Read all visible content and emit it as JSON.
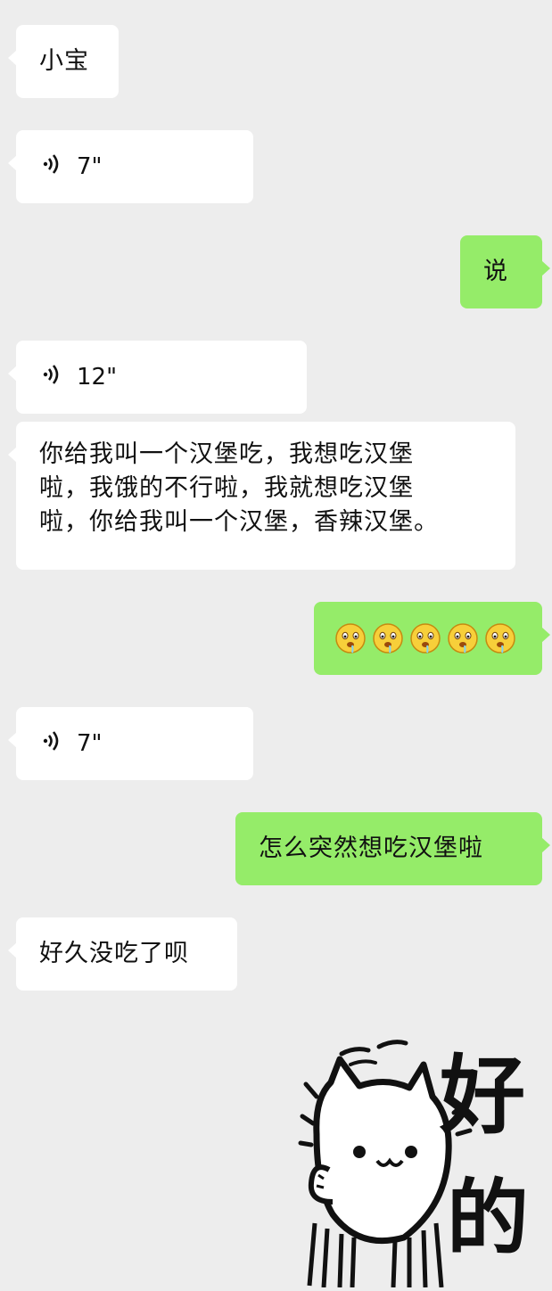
{
  "messages": [
    {
      "side": "left",
      "type": "text",
      "text": "小宝"
    },
    {
      "side": "left",
      "type": "voice",
      "duration": "7\""
    },
    {
      "side": "right",
      "type": "text",
      "text": "说"
    },
    {
      "side": "left",
      "type": "voice",
      "duration": "12\""
    },
    {
      "side": "left",
      "type": "text",
      "lines": [
        "你给我叫一个汉堡吃，我想吃汉堡",
        "啦，我饿的不行啦，我就想吃汉堡",
        "啦，你给我叫一个汉堡，香辣汉堡。"
      ]
    },
    {
      "side": "right",
      "type": "emoji",
      "emoji": "drooling-face",
      "count": 5
    },
    {
      "side": "left",
      "type": "voice",
      "duration": "7\""
    },
    {
      "side": "right",
      "type": "text",
      "text": "怎么突然想吃汉堡啦"
    },
    {
      "side": "left",
      "type": "text",
      "text": "好久没吃了呗"
    }
  ],
  "sticker": {
    "chars": [
      "好",
      "的"
    ],
    "icon": "cat-sticker"
  },
  "colors": {
    "background": "#ededed",
    "incoming": "#ffffff",
    "outgoing": "#95ec69"
  }
}
